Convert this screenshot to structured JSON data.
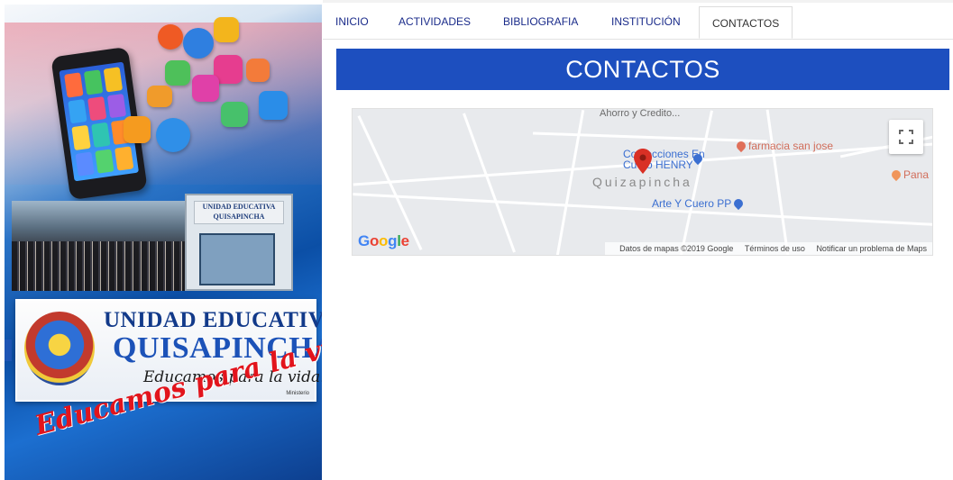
{
  "nav": {
    "tabs": [
      {
        "label": "INICIO",
        "active": false
      },
      {
        "label": "ACTIVIDADES",
        "active": false
      },
      {
        "label": "BIBLIOGRAFIA",
        "active": false
      },
      {
        "label": "INSTITUCIÓN",
        "active": false
      },
      {
        "label": "CONTACTOS",
        "active": true
      }
    ]
  },
  "page": {
    "title": "CONTACTOS"
  },
  "banner": {
    "logo_line1": "UNIDAD EDUCATIVA",
    "logo_line2": "QUISAPINCHA",
    "motto": "Educamos para la vida.",
    "slogan": "Educamos para la vida...",
    "building_sign": "UNIDAD EDUCATIVA QUISAPINCHA",
    "ministerio": "Ministerio"
  },
  "map": {
    "town_label": "Quizapincha",
    "top_label": "Ahorro y Credito...",
    "pois": {
      "farmacia": "farmacia san jose",
      "confecciones": "Confecciones En",
      "confecciones2": "Cuero HENRY",
      "arte": "Arte Y Cuero PP",
      "pana": "Pana"
    },
    "google_logo": "Google",
    "footer": {
      "data_credit": "Datos de mapas ©2019 Google",
      "terms": "Términos de uso",
      "report": "Notificar un problema de Maps"
    }
  },
  "colors": {
    "header_bg": "#1d4fbf",
    "nav_text": "#1a2b8a",
    "marker": "#d93025"
  }
}
